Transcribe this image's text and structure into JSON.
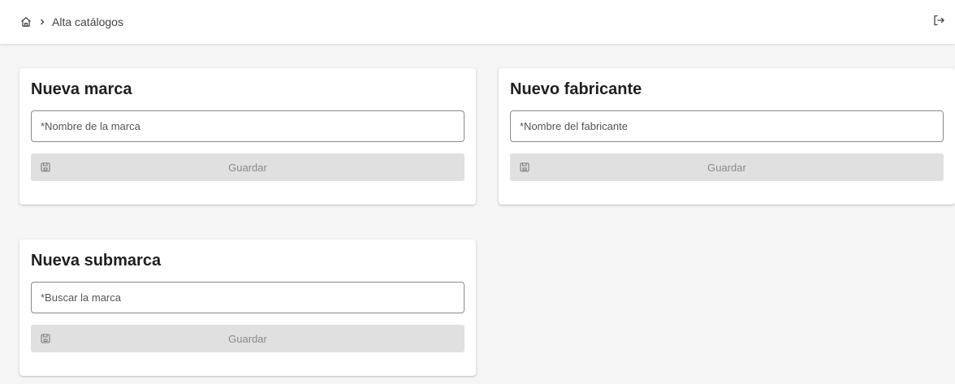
{
  "header": {
    "breadcrumb_current": "Alta catálogos"
  },
  "cards": [
    {
      "title": "Nueva marca",
      "placeholder": "*Nombre de la marca",
      "button_label": "Guardar"
    },
    {
      "title": "Nuevo fabricante",
      "placeholder": "*Nombre del fabricante",
      "button_label": "Guardar"
    },
    {
      "title": "Nueva submarca",
      "placeholder": "*Buscar la marca",
      "button_label": "Guardar"
    }
  ],
  "colors": {
    "page_background": "#f5f5f5",
    "card_background": "#ffffff",
    "button_disabled_bg": "#e0e0e0",
    "button_disabled_text": "#8a8a8a"
  },
  "icons": [
    "home-icon",
    "chevron-right-icon",
    "logout-icon",
    "save-icon"
  ]
}
